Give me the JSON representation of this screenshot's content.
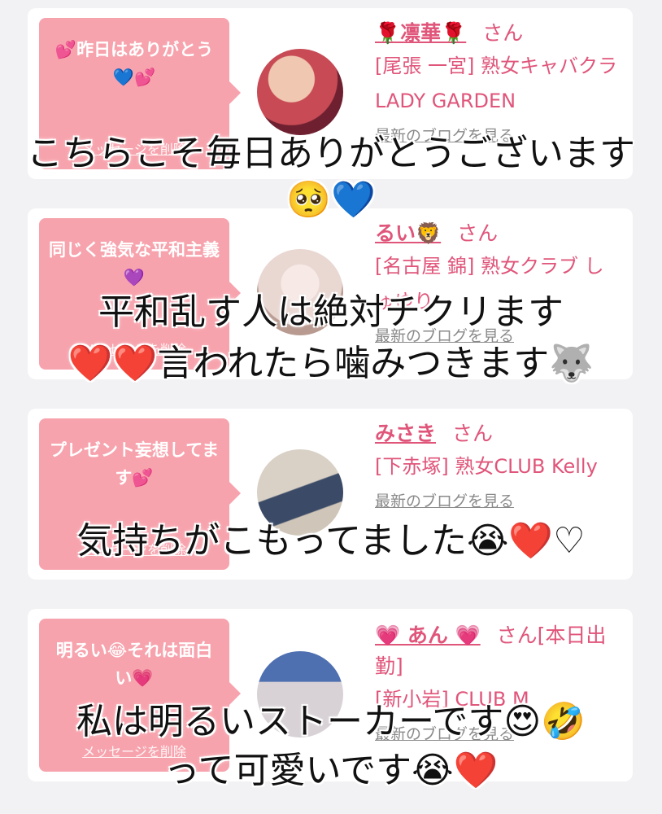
{
  "cards": [
    {
      "bubble_text": "💕昨日はありがとう💙💕",
      "delete_label": "メッセージを削除",
      "name": "🌹凛華🌹",
      "san": "さん",
      "shop": "[尾張 一宮] 熟女キャバクラ LADY GARDEN",
      "blog": "最新のブログを見る",
      "avatar_colors": [
        "#c74a55",
        "#f0c7b0"
      ]
    },
    {
      "bubble_text": "同じく強気な平和主義💜",
      "delete_label": "メッセージを削除",
      "name": "るい🦁",
      "san": "さん",
      "shop": "[名古屋 錦] 熟女クラブ しゅゆり",
      "blog": "最新のブログを見る",
      "avatar_colors": [
        "#e9d7d2",
        "#f6e9e6"
      ]
    },
    {
      "bubble_text": "プレゼント妄想してます💕",
      "delete_label": "メッセージを削除",
      "name": "みさき",
      "san": "さん",
      "shop": "[下赤塚] 熟女CLUB Kelly",
      "blog": "最新のブログを見る",
      "avatar_colors": [
        "#cfc5b8",
        "#3b4a66"
      ]
    },
    {
      "bubble_text": "明るい😂それは面白い💗",
      "delete_label": "メッセージを削除",
      "name": "💗 あん 💗",
      "san": "さん[本日出勤]",
      "shop": "[新小岩] CLUB M",
      "blog": "最新のブログを見る",
      "avatar_colors": [
        "#4e6fb0",
        "#d8d2d6"
      ]
    }
  ],
  "overlays": [
    "こちらこそ毎日ありがとうございます🥺💙",
    "平和乱す人は絶対チクリます",
    "❤️❤️言われたら噛みつきます🐺",
    "気持ちがこもってました😭❤️♡",
    "私は明るいストーカーです😍🤣",
    "って可愛いです😭❤️"
  ]
}
